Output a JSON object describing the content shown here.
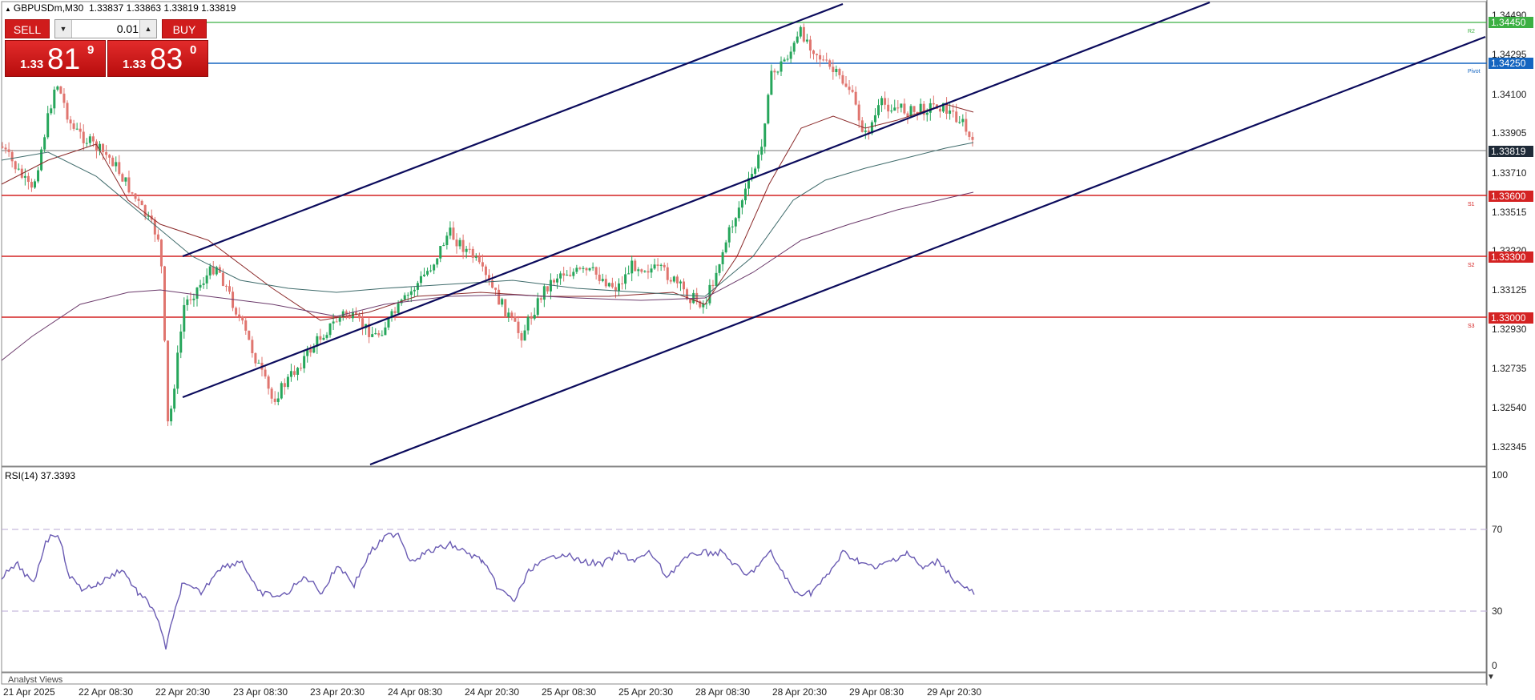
{
  "header": {
    "symbol_info": "GBPUSDm,M30",
    "ohlc": "1.33837 1.33863 1.33819 1.33819"
  },
  "trade_panel": {
    "sell_label": "SELL",
    "buy_label": "BUY",
    "lot_value": "0.01",
    "sell_price": {
      "prefix": "1.33",
      "big": "81",
      "sup": "9"
    },
    "buy_price": {
      "prefix": "1.33",
      "big": "83",
      "sup": "0"
    }
  },
  "price_axis": {
    "ticks": [
      "1.34490",
      "1.34295",
      "1.34100",
      "1.33905",
      "1.33710",
      "1.33515",
      "1.33320",
      "1.33125",
      "1.32930",
      "1.32735",
      "1.32540",
      "1.32345"
    ],
    "tags": {
      "r2": "1.34450",
      "pivot": "1.34250",
      "current": "1.33819",
      "s1": "1.33600",
      "s2": "1.33300",
      "s3": "1.33000"
    },
    "level_labels": {
      "r2": "R2",
      "pivot": "Pivot",
      "s1": "S1",
      "s2": "S2",
      "s3": "S3"
    }
  },
  "time_axis": [
    "21 Apr 2025",
    "22 Apr 08:30",
    "22 Apr 20:30",
    "23 Apr 08:30",
    "23 Apr 20:30",
    "24 Apr 08:30",
    "24 Apr 20:30",
    "25 Apr 08:30",
    "25 Apr 20:30",
    "28 Apr 08:30",
    "28 Apr 20:30",
    "29 Apr 08:30",
    "29 Apr 20:30"
  ],
  "rsi": {
    "label": "RSI(14) 37.3393",
    "axis": [
      "100",
      "70",
      "30",
      "0"
    ]
  },
  "bottom_panel": {
    "label": "Analyst Views"
  },
  "colors": {
    "bull": "#26a65b",
    "bear": "#e0756f",
    "channel": "#0b0b5c",
    "support": "#d42222",
    "pivot": "#1565c0",
    "r2": "#3cb043",
    "rsi_line": "#6a5bb3"
  },
  "icons": {
    "panel_collapse": "triangle-icon",
    "lot_decrease": "chevron-down-icon",
    "lot_increase": "chevron-up-icon"
  }
}
